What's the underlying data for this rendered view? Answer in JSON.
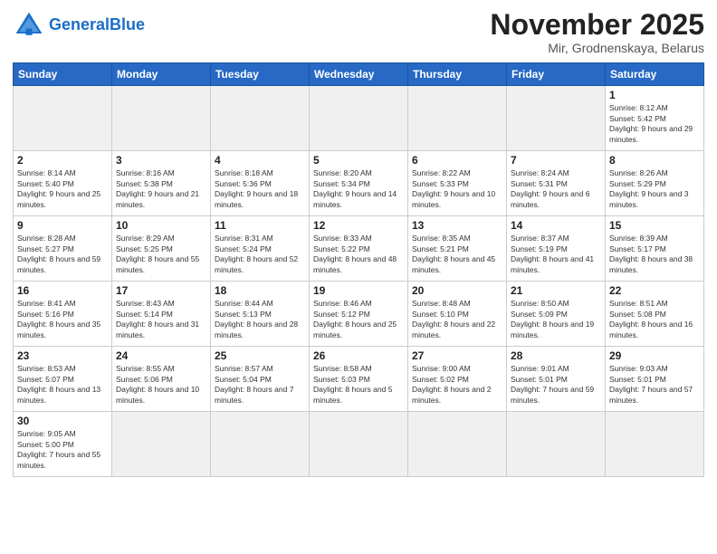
{
  "header": {
    "logo_general": "General",
    "logo_blue": "Blue",
    "title": "November 2025",
    "subtitle": "Mir, Grodnenskaya, Belarus"
  },
  "days_of_week": [
    "Sunday",
    "Monday",
    "Tuesday",
    "Wednesday",
    "Thursday",
    "Friday",
    "Saturday"
  ],
  "weeks": [
    [
      {
        "day": "",
        "empty": true
      },
      {
        "day": "",
        "empty": true
      },
      {
        "day": "",
        "empty": true
      },
      {
        "day": "",
        "empty": true
      },
      {
        "day": "",
        "empty": true
      },
      {
        "day": "",
        "empty": true
      },
      {
        "day": "1",
        "sunrise": "Sunrise: 8:12 AM",
        "sunset": "Sunset: 5:42 PM",
        "daylight": "Daylight: 9 hours and 29 minutes."
      }
    ],
    [
      {
        "day": "2",
        "sunrise": "Sunrise: 8:14 AM",
        "sunset": "Sunset: 5:40 PM",
        "daylight": "Daylight: 9 hours and 25 minutes."
      },
      {
        "day": "3",
        "sunrise": "Sunrise: 8:16 AM",
        "sunset": "Sunset: 5:38 PM",
        "daylight": "Daylight: 9 hours and 21 minutes."
      },
      {
        "day": "4",
        "sunrise": "Sunrise: 8:18 AM",
        "sunset": "Sunset: 5:36 PM",
        "daylight": "Daylight: 9 hours and 18 minutes."
      },
      {
        "day": "5",
        "sunrise": "Sunrise: 8:20 AM",
        "sunset": "Sunset: 5:34 PM",
        "daylight": "Daylight: 9 hours and 14 minutes."
      },
      {
        "day": "6",
        "sunrise": "Sunrise: 8:22 AM",
        "sunset": "Sunset: 5:33 PM",
        "daylight": "Daylight: 9 hours and 10 minutes."
      },
      {
        "day": "7",
        "sunrise": "Sunrise: 8:24 AM",
        "sunset": "Sunset: 5:31 PM",
        "daylight": "Daylight: 9 hours and 6 minutes."
      },
      {
        "day": "8",
        "sunrise": "Sunrise: 8:26 AM",
        "sunset": "Sunset: 5:29 PM",
        "daylight": "Daylight: 9 hours and 3 minutes."
      }
    ],
    [
      {
        "day": "9",
        "sunrise": "Sunrise: 8:28 AM",
        "sunset": "Sunset: 5:27 PM",
        "daylight": "Daylight: 8 hours and 59 minutes."
      },
      {
        "day": "10",
        "sunrise": "Sunrise: 8:29 AM",
        "sunset": "Sunset: 5:25 PM",
        "daylight": "Daylight: 8 hours and 55 minutes."
      },
      {
        "day": "11",
        "sunrise": "Sunrise: 8:31 AM",
        "sunset": "Sunset: 5:24 PM",
        "daylight": "Daylight: 8 hours and 52 minutes."
      },
      {
        "day": "12",
        "sunrise": "Sunrise: 8:33 AM",
        "sunset": "Sunset: 5:22 PM",
        "daylight": "Daylight: 8 hours and 48 minutes."
      },
      {
        "day": "13",
        "sunrise": "Sunrise: 8:35 AM",
        "sunset": "Sunset: 5:21 PM",
        "daylight": "Daylight: 8 hours and 45 minutes."
      },
      {
        "day": "14",
        "sunrise": "Sunrise: 8:37 AM",
        "sunset": "Sunset: 5:19 PM",
        "daylight": "Daylight: 8 hours and 41 minutes."
      },
      {
        "day": "15",
        "sunrise": "Sunrise: 8:39 AM",
        "sunset": "Sunset: 5:17 PM",
        "daylight": "Daylight: 8 hours and 38 minutes."
      }
    ],
    [
      {
        "day": "16",
        "sunrise": "Sunrise: 8:41 AM",
        "sunset": "Sunset: 5:16 PM",
        "daylight": "Daylight: 8 hours and 35 minutes."
      },
      {
        "day": "17",
        "sunrise": "Sunrise: 8:43 AM",
        "sunset": "Sunset: 5:14 PM",
        "daylight": "Daylight: 8 hours and 31 minutes."
      },
      {
        "day": "18",
        "sunrise": "Sunrise: 8:44 AM",
        "sunset": "Sunset: 5:13 PM",
        "daylight": "Daylight: 8 hours and 28 minutes."
      },
      {
        "day": "19",
        "sunrise": "Sunrise: 8:46 AM",
        "sunset": "Sunset: 5:12 PM",
        "daylight": "Daylight: 8 hours and 25 minutes."
      },
      {
        "day": "20",
        "sunrise": "Sunrise: 8:48 AM",
        "sunset": "Sunset: 5:10 PM",
        "daylight": "Daylight: 8 hours and 22 minutes."
      },
      {
        "day": "21",
        "sunrise": "Sunrise: 8:50 AM",
        "sunset": "Sunset: 5:09 PM",
        "daylight": "Daylight: 8 hours and 19 minutes."
      },
      {
        "day": "22",
        "sunrise": "Sunrise: 8:51 AM",
        "sunset": "Sunset: 5:08 PM",
        "daylight": "Daylight: 8 hours and 16 minutes."
      }
    ],
    [
      {
        "day": "23",
        "sunrise": "Sunrise: 8:53 AM",
        "sunset": "Sunset: 5:07 PM",
        "daylight": "Daylight: 8 hours and 13 minutes."
      },
      {
        "day": "24",
        "sunrise": "Sunrise: 8:55 AM",
        "sunset": "Sunset: 5:06 PM",
        "daylight": "Daylight: 8 hours and 10 minutes."
      },
      {
        "day": "25",
        "sunrise": "Sunrise: 8:57 AM",
        "sunset": "Sunset: 5:04 PM",
        "daylight": "Daylight: 8 hours and 7 minutes."
      },
      {
        "day": "26",
        "sunrise": "Sunrise: 8:58 AM",
        "sunset": "Sunset: 5:03 PM",
        "daylight": "Daylight: 8 hours and 5 minutes."
      },
      {
        "day": "27",
        "sunrise": "Sunrise: 9:00 AM",
        "sunset": "Sunset: 5:02 PM",
        "daylight": "Daylight: 8 hours and 2 minutes."
      },
      {
        "day": "28",
        "sunrise": "Sunrise: 9:01 AM",
        "sunset": "Sunset: 5:01 PM",
        "daylight": "Daylight: 7 hours and 59 minutes."
      },
      {
        "day": "29",
        "sunrise": "Sunrise: 9:03 AM",
        "sunset": "Sunset: 5:01 PM",
        "daylight": "Daylight: 7 hours and 57 minutes."
      }
    ],
    [
      {
        "day": "30",
        "sunrise": "Sunrise: 9:05 AM",
        "sunset": "Sunset: 5:00 PM",
        "daylight": "Daylight: 7 hours and 55 minutes."
      },
      {
        "day": "",
        "empty": true
      },
      {
        "day": "",
        "empty": true
      },
      {
        "day": "",
        "empty": true
      },
      {
        "day": "",
        "empty": true
      },
      {
        "day": "",
        "empty": true
      },
      {
        "day": "",
        "empty": true
      }
    ]
  ]
}
